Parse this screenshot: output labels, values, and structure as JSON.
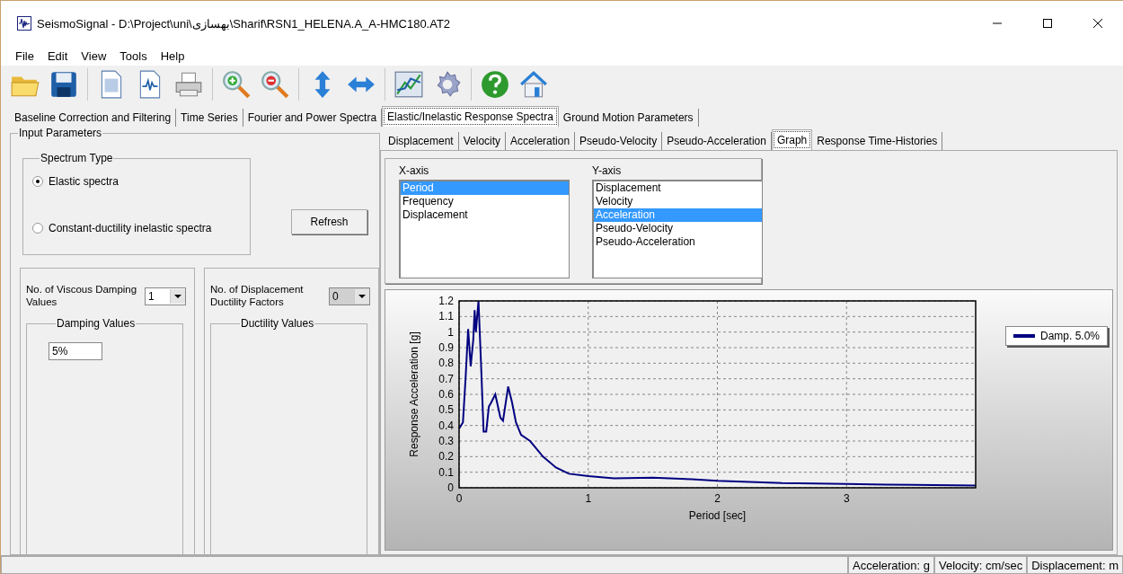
{
  "window": {
    "title": "SeismoSignal - D:\\Project\\uni\\بهسازی\\Sharif\\RSN1_HELENA.A_A-HMC180.AT2"
  },
  "menu": [
    {
      "label": "File"
    },
    {
      "label": "Edit"
    },
    {
      "label": "View"
    },
    {
      "label": "Tools"
    },
    {
      "label": "Help"
    }
  ],
  "main_tabs": [
    {
      "label": "Baseline Correction and Filtering",
      "selected": false
    },
    {
      "label": "Time Series",
      "selected": false
    },
    {
      "label": "Fourier and Power Spectra",
      "selected": false
    },
    {
      "label": "Elastic/Inelastic Response Spectra",
      "selected": true
    },
    {
      "label": "Ground Motion Parameters",
      "selected": false
    }
  ],
  "input_parameters": {
    "title": "Input Parameters",
    "spectrum_type": {
      "title": "Spectrum Type",
      "options": [
        {
          "label": "Elastic spectra",
          "selected": true
        },
        {
          "label": "Constant-ductility inelastic spectra",
          "selected": false
        }
      ]
    },
    "refresh_button": "Refresh",
    "damping": {
      "label": "No. of Viscous Damping Values",
      "value": "1",
      "disabled": false,
      "group_title": "Damping Values",
      "values": [
        "5%"
      ]
    },
    "ductility": {
      "label": "No. of Displacement Ductility Factors",
      "value": "0",
      "disabled": true,
      "group_title": "Ductility Values"
    }
  },
  "sub_tabs": [
    {
      "label": "Displacement",
      "selected": false
    },
    {
      "label": "Velocity",
      "selected": false
    },
    {
      "label": "Acceleration",
      "selected": false
    },
    {
      "label": "Pseudo-Velocity",
      "selected": false
    },
    {
      "label": "Pseudo-Acceleration",
      "selected": false
    },
    {
      "label": "Graph",
      "selected": true
    },
    {
      "label": "Response Time-Histories",
      "selected": false
    }
  ],
  "x_axis": {
    "title": "X-axis",
    "items": [
      {
        "label": "Period",
        "selected": true
      },
      {
        "label": "Frequency",
        "selected": false
      },
      {
        "label": "Displacement",
        "selected": false
      }
    ]
  },
  "y_axis": {
    "title": "Y-axis",
    "items": [
      {
        "label": "Displacement",
        "selected": false
      },
      {
        "label": "Velocity",
        "selected": false
      },
      {
        "label": "Acceleration",
        "selected": true
      },
      {
        "label": "Pseudo-Velocity",
        "selected": false
      },
      {
        "label": "Pseudo-Acceleration",
        "selected": false
      }
    ]
  },
  "chart": {
    "chart_data": {
      "type": "line",
      "xlabel": "Period [sec]",
      "ylabel": "Response Acceleration [g]",
      "x": [
        0,
        0.03,
        0.05,
        0.07,
        0.09,
        0.11,
        0.12,
        0.13,
        0.14,
        0.15,
        0.17,
        0.19,
        0.21,
        0.23,
        0.25,
        0.28,
        0.32,
        0.34,
        0.38,
        0.41,
        0.44,
        0.48,
        0.55,
        0.65,
        0.75,
        0.85,
        1.0,
        1.2,
        1.5,
        1.8,
        2.0,
        2.5,
        3.0,
        3.3,
        4.0
      ],
      "series": [
        {
          "name": "Damp. 5.0%",
          "color": "#000080",
          "values": [
            0.38,
            0.42,
            0.7,
            1.02,
            0.78,
            0.95,
            1.14,
            1.0,
            1.1,
            1.2,
            0.8,
            0.36,
            0.36,
            0.52,
            0.55,
            0.6,
            0.45,
            0.43,
            0.65,
            0.55,
            0.42,
            0.34,
            0.3,
            0.2,
            0.13,
            0.09,
            0.075,
            0.06,
            0.065,
            0.055,
            0.045,
            0.03,
            0.025,
            0.02,
            0.015
          ]
        }
      ],
      "grid": true,
      "xlim": [
        0,
        4
      ],
      "ylim": [
        0,
        1.2
      ],
      "xticks": [
        0,
        1,
        2,
        3
      ],
      "yticks": [
        0,
        0.1,
        0.2,
        0.3,
        0.4,
        0.5,
        0.6,
        0.7,
        0.8,
        0.9,
        1,
        1.1,
        1.2
      ]
    }
  },
  "status_bar": [
    "Acceleration: g",
    "Velocity: cm/sec",
    "Displacement: m"
  ]
}
